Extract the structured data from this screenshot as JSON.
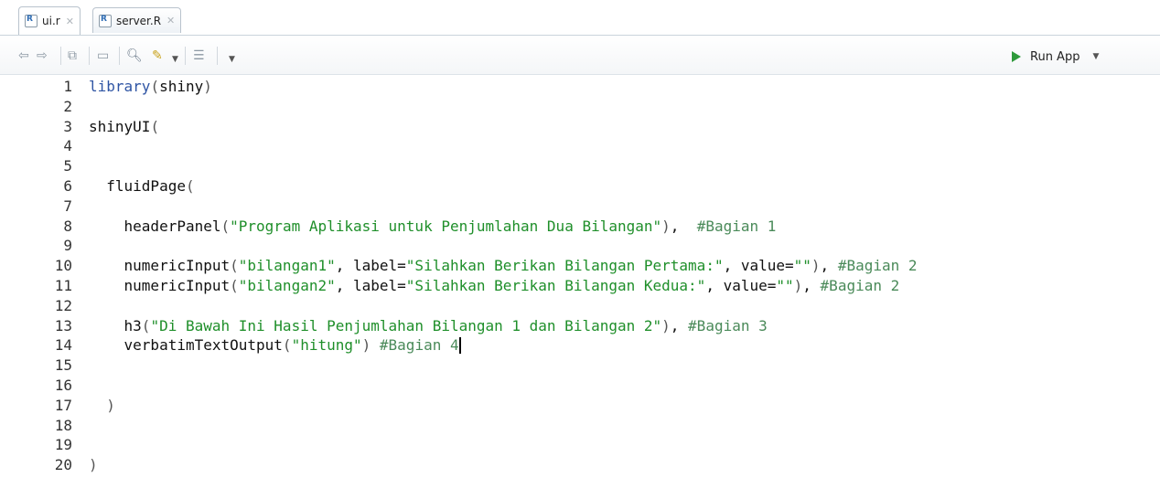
{
  "tabs": [
    {
      "label": "ui.r",
      "active": true
    },
    {
      "label": "server.R",
      "active": false
    }
  ],
  "toolbar": {
    "run_label": "Run App"
  },
  "editor": {
    "lines": [
      {
        "n": "1",
        "parts": [
          [
            "kw",
            "library"
          ],
          [
            "paren",
            "("
          ],
          [
            "attr",
            "shiny"
          ],
          [
            "paren",
            ")"
          ]
        ]
      },
      {
        "n": "2",
        "parts": []
      },
      {
        "n": "3",
        "parts": [
          [
            "attr",
            "shinyUI"
          ],
          [
            "paren",
            "("
          ]
        ]
      },
      {
        "n": "4",
        "parts": []
      },
      {
        "n": "5",
        "parts": []
      },
      {
        "n": "6",
        "parts": [
          [
            "attr",
            "  fluidPage"
          ],
          [
            "paren",
            "("
          ]
        ]
      },
      {
        "n": "7",
        "parts": []
      },
      {
        "n": "8",
        "parts": [
          [
            "attr",
            "    headerPanel"
          ],
          [
            "paren",
            "("
          ],
          [
            "str",
            "\"Program Aplikasi untuk Penjumlahan Dua Bilangan\""
          ],
          [
            "paren",
            ")"
          ],
          [
            "attr",
            ",  "
          ],
          [
            "com",
            "#Bagian 1"
          ]
        ]
      },
      {
        "n": "9",
        "parts": []
      },
      {
        "n": "10",
        "parts": [
          [
            "attr",
            "    numericInput"
          ],
          [
            "paren",
            "("
          ],
          [
            "str",
            "\"bilangan1\""
          ],
          [
            "attr",
            ", label="
          ],
          [
            "str",
            "\"Silahkan Berikan Bilangan Pertama:\""
          ],
          [
            "attr",
            ", value="
          ],
          [
            "str",
            "\"\""
          ],
          [
            "paren",
            ")"
          ],
          [
            "attr",
            ", "
          ],
          [
            "com",
            "#Bagian 2"
          ]
        ]
      },
      {
        "n": "11",
        "parts": [
          [
            "attr",
            "    numericInput"
          ],
          [
            "paren",
            "("
          ],
          [
            "str",
            "\"bilangan2\""
          ],
          [
            "attr",
            ", label="
          ],
          [
            "str",
            "\"Silahkan Berikan Bilangan Kedua:\""
          ],
          [
            "attr",
            ", value="
          ],
          [
            "str",
            "\"\""
          ],
          [
            "paren",
            ")"
          ],
          [
            "attr",
            ", "
          ],
          [
            "com",
            "#Bagian 2"
          ]
        ]
      },
      {
        "n": "12",
        "parts": []
      },
      {
        "n": "13",
        "parts": [
          [
            "attr",
            "    h3"
          ],
          [
            "paren",
            "("
          ],
          [
            "str",
            "\"Di Bawah Ini Hasil Penjumlahan Bilangan 1 dan Bilangan 2\""
          ],
          [
            "paren",
            ")"
          ],
          [
            "attr",
            ", "
          ],
          [
            "com",
            "#Bagian 3"
          ]
        ]
      },
      {
        "n": "14",
        "parts": [
          [
            "attr",
            "    verbatimTextOutput"
          ],
          [
            "paren",
            "("
          ],
          [
            "str",
            "\"hitung\""
          ],
          [
            "paren",
            ")"
          ],
          [
            "attr",
            " "
          ],
          [
            "com",
            "#Bagian 4"
          ]
        ],
        "cursor": true
      },
      {
        "n": "15",
        "parts": []
      },
      {
        "n": "16",
        "parts": []
      },
      {
        "n": "17",
        "parts": [
          [
            "paren",
            "  )"
          ]
        ]
      },
      {
        "n": "18",
        "parts": []
      },
      {
        "n": "19",
        "parts": []
      },
      {
        "n": "20",
        "parts": [
          [
            "paren",
            ")"
          ]
        ]
      }
    ]
  }
}
